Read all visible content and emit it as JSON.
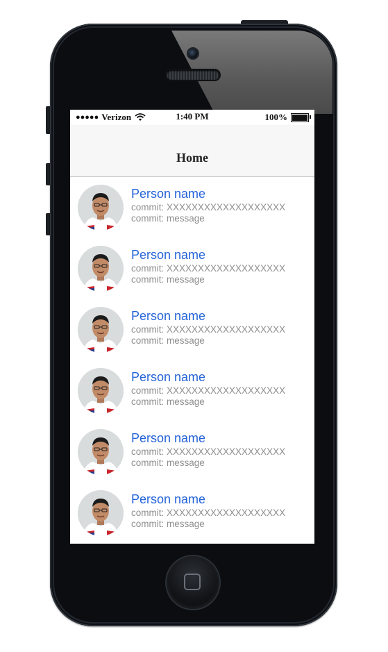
{
  "status_bar": {
    "signal": "●●●●●",
    "carrier": "Verizon",
    "time": "1:40 PM",
    "battery": "100%"
  },
  "nav": {
    "title": "Home"
  },
  "list": [
    {
      "name": "Person name",
      "hash": "commit: XXXXXXXXXXXXXXXXXXX",
      "message": "commit: message"
    },
    {
      "name": "Person name",
      "hash": "commit: XXXXXXXXXXXXXXXXXXX",
      "message": "commit: message"
    },
    {
      "name": "Person name",
      "hash": "commit: XXXXXXXXXXXXXXXXXXX",
      "message": "commit: message"
    },
    {
      "name": "Person name",
      "hash": "commit: XXXXXXXXXXXXXXXXXXX",
      "message": "commit: message"
    },
    {
      "name": "Person name",
      "hash": "commit: XXXXXXXXXXXXXXXXXXX",
      "message": "commit: message"
    },
    {
      "name": "Person name",
      "hash": "commit: XXXXXXXXXXXXXXXXXXX",
      "message": "commit: message"
    }
  ],
  "colors": {
    "link_blue": "#2463d8",
    "subtitle_gray": "#8e8e8e",
    "nav_background": "#f7f7f7",
    "phone_body": "#0b0d10"
  },
  "icons": {
    "wifi": "wifi-icon",
    "battery": "battery-icon",
    "avatar": "avatar-photo",
    "home": "home-button-icon"
  }
}
